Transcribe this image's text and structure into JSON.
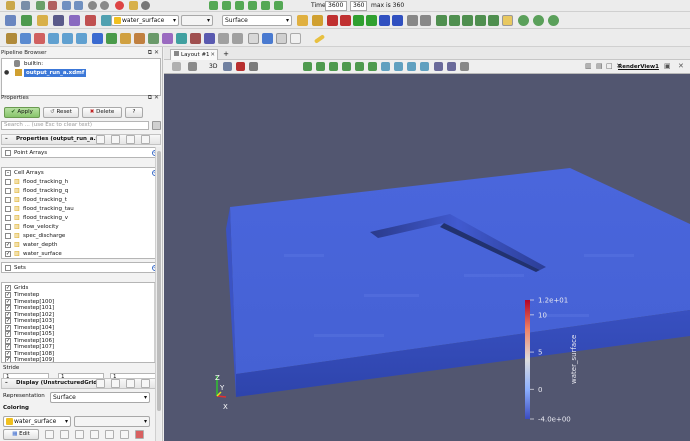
{
  "toolbar": {
    "time_label": "Time:",
    "time_value": "3600",
    "timestep_value": "360",
    "max_label": "max is 360",
    "variable_select": "water_surface",
    "component_select": "",
    "representation_select": "Surface"
  },
  "pipeline": {
    "title": "Pipeline Browser",
    "items": [
      {
        "label": "builtin:"
      },
      {
        "label": "output_run_a.xdmf"
      }
    ]
  },
  "properties": {
    "title": "Properties",
    "apply_label": "Apply",
    "reset_label": "Reset",
    "delete_label": "Delete",
    "help_label": "?",
    "search_placeholder": "Search ... (use Esc to clear text)",
    "section_label": "Properties (output_run_a.x",
    "point_arrays_label": "Point Arrays",
    "cell_arrays_label": "Cell Arrays",
    "cell_arrays": [
      {
        "label": "flood_tracking_h",
        "checked": false
      },
      {
        "label": "flood_tracking_q",
        "checked": false
      },
      {
        "label": "flood_tracking_t",
        "checked": false
      },
      {
        "label": "flood_tracking_tau",
        "checked": false
      },
      {
        "label": "flood_tracking_v",
        "checked": false
      },
      {
        "label": "flow_velocity",
        "checked": false
      },
      {
        "label": "spec_discharge",
        "checked": false
      },
      {
        "label": "water_depth",
        "checked": true
      },
      {
        "label": "water_surface",
        "checked": true
      }
    ],
    "sets_label": "Sets",
    "grids_label": "Grids",
    "grids": [
      "Timestep",
      "Timestep[100]",
      "Timestep[101]",
      "Timestep[102]",
      "Timestep[103]",
      "Timestep[104]",
      "Timestep[105]",
      "Timestep[106]",
      "Timestep[107]",
      "Timestep[108]",
      "Timestep[109]"
    ],
    "stride_label": "Stride",
    "stride_values": [
      "1",
      "1",
      "1"
    ]
  },
  "display": {
    "section_label": "Display (UnstructuredGrid)",
    "representation_label": "Representation",
    "representation_value": "Surface",
    "coloring_label": "Coloring",
    "coloring_value": "water_surface",
    "edit_label": "Edit"
  },
  "view": {
    "tab_label": "Layout #1",
    "add_tab": "+",
    "threed_label": "3D",
    "renderview_label": "RenderView1",
    "axes": {
      "x": "X",
      "y": "Y",
      "z": "Z"
    }
  },
  "colorbar": {
    "title": "water_surface",
    "ticks": [
      "1.2e+01",
      "10",
      "5",
      "0",
      "-4.0e+00"
    ],
    "range": [
      -4.0,
      12.0
    ],
    "colors": {
      "high": "#b40426",
      "mid": "#dddddd",
      "low": "#3b4cc0"
    }
  },
  "colors": {
    "viewport_bg": "#525670",
    "surface": "#4d6be0",
    "apply_green": "#9ad07e",
    "selection": "#3c78d8"
  }
}
